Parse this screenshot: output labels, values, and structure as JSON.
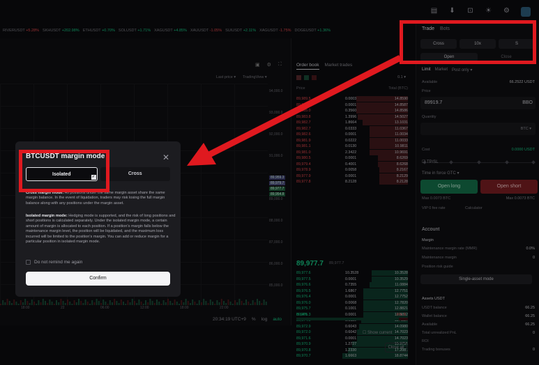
{
  "topbar": {
    "icons": [
      "wallet-icon",
      "download-icon",
      "gift-icon",
      "sun-icon",
      "gear-icon",
      "avatar"
    ]
  },
  "ticker": [
    {
      "sym": "RIVERUSDT",
      "chg": "+5.28%",
      "dir": "dn"
    },
    {
      "sym": "SKHUSDT",
      "chg": "+202.98%",
      "dir": "up"
    },
    {
      "sym": "ETHUSDT",
      "chg": "+0.70%",
      "dir": "up"
    },
    {
      "sym": "SOLUSDT",
      "chg": "+1.71%",
      "dir": "up"
    },
    {
      "sym": "XAGUSDT",
      "chg": "+4.85%",
      "dir": "up"
    },
    {
      "sym": "XAUUSDT",
      "chg": "-1.05%",
      "dir": "dn"
    },
    {
      "sym": "SUIUSDT",
      "chg": "+2.11%",
      "dir": "up"
    },
    {
      "sym": "XAGUSDT",
      "chg": "-1.75%",
      "dir": "dn"
    },
    {
      "sym": "DOGEUSDT",
      "chg": "+1.36%",
      "dir": "up"
    }
  ],
  "chart": {
    "menu": [
      "Last price ▾",
      "TradingView ▾"
    ],
    "price_ticks": [
      "94,000.0",
      "93,000.0",
      "92,000.0",
      "91,000.0",
      "90,000.0",
      "89,000.0",
      "88,000.0",
      "87,000.0",
      "86,000.0",
      "85,000.0"
    ],
    "price_badges": [
      "89,959.3",
      "89,979.7",
      "89,977.7",
      "89,954.8"
    ],
    "time_ticks": [
      "18:00",
      "22",
      "06:00",
      "12:00",
      "18:00",
      "22:00"
    ],
    "footer": {
      "time": "20:34:19 UTC+9",
      "pct": "%",
      "log": "log",
      "auto": "auto"
    }
  },
  "orderbook": {
    "tabs": [
      "Order book",
      "Market trades"
    ],
    "step": "0.1 ▾",
    "head": {
      "price": "Price",
      "size": "Size",
      "total": "Total (BTC)"
    },
    "asks": [
      [
        "89,989.5",
        "0.0003",
        "14.8590"
      ],
      [
        "89,988.1",
        "0.0001",
        "14.8587"
      ],
      [
        "89,985.0",
        "0.3560",
        "14.8586"
      ],
      [
        "89,983.8",
        "1.3996",
        "14.5027"
      ],
      [
        "89,982.7",
        "1.8664",
        "13.1031"
      ],
      [
        "89,982.7",
        "0.0333",
        "11.0367"
      ],
      [
        "89,982.6",
        "0.0001",
        "11.0034"
      ],
      [
        "89,981.9",
        "0.0222",
        "11.0033"
      ],
      [
        "89,981.1",
        "0.0130",
        "10.9811"
      ],
      [
        "89,981.0",
        "2.3422",
        "10.9691"
      ],
      [
        "89,980.5",
        "0.0001",
        "8.6269"
      ],
      [
        "89,979.4",
        "0.4001",
        "8.6268"
      ],
      [
        "89,978.9",
        "0.0058",
        "8.2167"
      ],
      [
        "89,977.9",
        "0.0001",
        "8.2129"
      ],
      [
        "89,977.8",
        "8.2128",
        "8.2128"
      ]
    ],
    "mid": "89,977.7",
    "mid_sub": "89,977.7",
    "bids": [
      [
        "89,977.6",
        "10.3528",
        "10.3528"
      ],
      [
        "89,977.5",
        "0.0001",
        "10.3529"
      ],
      [
        "89,976.6",
        "0.7355",
        "11.0884"
      ],
      [
        "89,976.5",
        "1.6867",
        "12.7751"
      ],
      [
        "89,976.4",
        "0.0001",
        "12.7752"
      ],
      [
        "89,976.0",
        "0.0068",
        "12.7820"
      ],
      [
        "89,975.7",
        "0.1001",
        "12.8821"
      ],
      [
        "89,975.3",
        "0.0001",
        "12.8822"
      ],
      [
        "89,974.0",
        "0.6116",
        "13.4937"
      ],
      [
        "89,972.9",
        "0.6043",
        "14.0980"
      ],
      [
        "89,972.0",
        "0.6042",
        "14.7023"
      ],
      [
        "89,971.6",
        "0.0001",
        "14.7023"
      ],
      [
        "89,970.9",
        "1.2727",
        "15.9751"
      ],
      [
        "89,970.8",
        "1.2330",
        "17.2081"
      ],
      [
        "89,970.7",
        "1.6663",
        "18.8744"
      ]
    ],
    "ratio_left": "B 94%",
    "ratio_right": "6% S",
    "show_current": "Show current",
    "close_all": "Close all"
  },
  "trade": {
    "tabs": [
      "Trade",
      "Bots"
    ],
    "mode": [
      "Cross",
      "10x",
      "S"
    ],
    "open": "Open",
    "close": "Close",
    "types": [
      "Limit",
      "Market",
      "Post only ▾"
    ],
    "available_label": "Available",
    "available_value": "66.2522 USDT",
    "price_label": "Price",
    "price_value": "89919.7",
    "bbo": "BBO",
    "qty_label": "Quantity",
    "qty_unit": "BTC ▾",
    "cost_label": "Cost",
    "cost_value": "0.0000 USDT",
    "tpsl": "TP/SL",
    "tif": "Time in force GTC ▾",
    "open_long": "Open long",
    "open_short": "Open short",
    "max_label": "Max 0.0073 BTC",
    "max_label_r": "Max 0.0073 BTC",
    "vip": "VIP 0 fee rate",
    "calc": "Calculator",
    "account": "Account",
    "margin": "Margin",
    "maint_rate": "Maintenance margin rate (MMR)",
    "maint_margin": "Maintenance margin",
    "pos_risk": "Position risk guide",
    "single_asset": "Single-asset mode",
    "assets": "Assets USDT",
    "usdt_balance": "USDT balance",
    "wallet_balance": "Wallet balance",
    "available": "Available",
    "unrealized": "Total unrealized PnL",
    "bonus": "Trading bonuses",
    "bal_val": "66.25",
    "bal_val2": "66.25",
    "bal_val3": "66.25",
    "mmr_val": "0.0%",
    "mm_val": "0",
    "pnl_val": "0",
    "bonus_val": "0",
    "roi": "ROI"
  },
  "modal": {
    "title": "BTCUSDT margin mode",
    "isolated": "Isolated",
    "cross": "Cross",
    "cross_heading": "Cross margin mode:",
    "cross_text": " All positions under the same margin asset share the same margin balance. In the event of liquidation, traders may risk losing the full margin balance along with any positions under the margin asset.",
    "iso_heading": "Isolated margin mode:",
    "iso_text": " Hedging mode is supported, and the risk of long positions and short positions is calculated separately. Under the isolated margin mode, a certain amount of margin is allocated to each position. If a position's margin falls below the maintenance margin level, the position will be liquidated, and the maximum loss incurred will be limited to the position's margin. You can add or reduce margin for a particular position in isolated margin mode.",
    "remember": "Do not remind me again",
    "confirm": "Confirm"
  },
  "colors": {
    "accent": "#e0191f",
    "up": "#16c784",
    "down": "#e5484d"
  }
}
